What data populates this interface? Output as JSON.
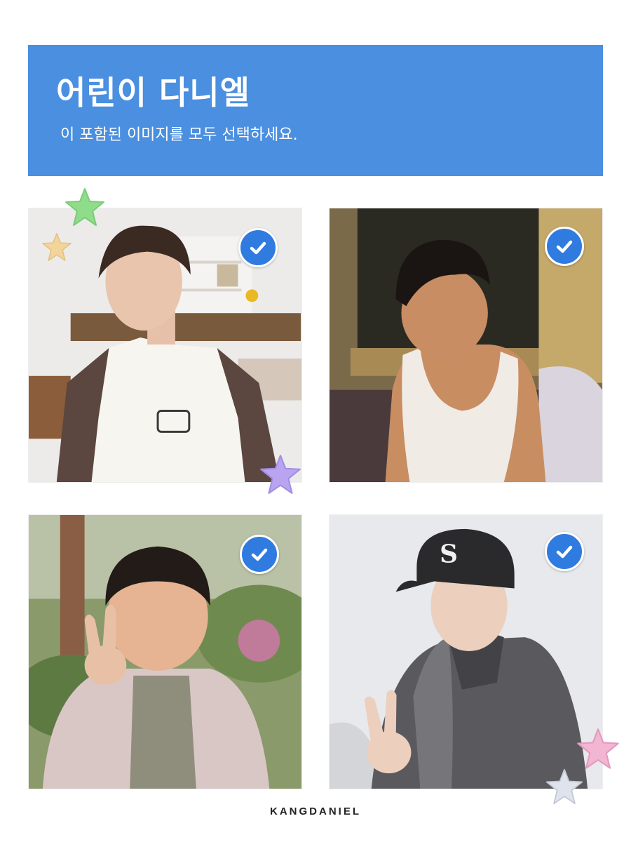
{
  "header": {
    "title": "어린이 다니엘",
    "subtitle": "이 포함된 이미지를 모두 선택하세요."
  },
  "tiles": [
    {
      "selected": true
    },
    {
      "selected": true
    },
    {
      "selected": true
    },
    {
      "selected": true
    }
  ],
  "footer": {
    "brand": "KANGDANIEL"
  },
  "colors": {
    "header_bg": "#4a8fe0",
    "check_bg": "#2f7be0",
    "star_green": "#8fdc8a",
    "star_yellow": "#f3d59b",
    "star_purple": "#b9a4f2",
    "star_pink": "#f3b6d2",
    "star_silver": "#dfe3ee"
  },
  "icons": [
    "check-icon",
    "star-icon"
  ]
}
